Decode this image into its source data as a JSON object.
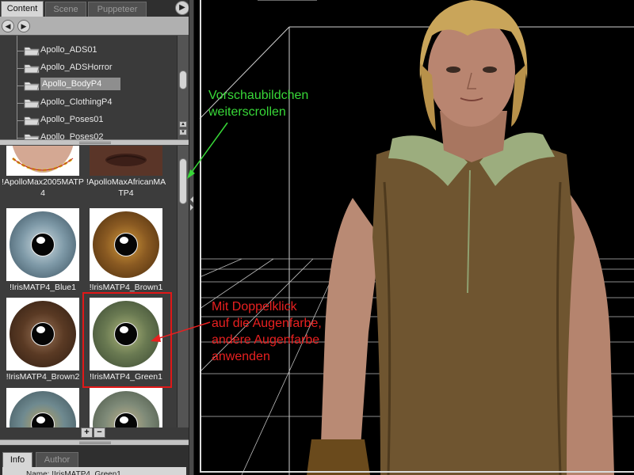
{
  "left_panel": {
    "tabs": [
      {
        "label": "Content",
        "active": true
      },
      {
        "label": "Scene",
        "active": false
      },
      {
        "label": "Puppeteer",
        "active": false
      }
    ],
    "folders": [
      {
        "label": "Apollo_ADS01",
        "selected": false
      },
      {
        "label": "Apollo_ADSHorror",
        "selected": false
      },
      {
        "label": "Apollo_BodyP4",
        "selected": true
      },
      {
        "label": "Apollo_ClothingP4",
        "selected": false
      },
      {
        "label": "Apollo_Poses01",
        "selected": false
      },
      {
        "label": "Apollo_Poses02",
        "selected": false
      }
    ],
    "thumbnails": [
      {
        "caption": "!ApolloMax2005MATP4",
        "kind": "face"
      },
      {
        "caption": "!ApolloMaxAfricanMATP4",
        "kind": "lips"
      },
      {
        "caption": "!IrisMATP4_Blue1",
        "kind": "iris",
        "color": "#7f9aa8"
      },
      {
        "caption": "!IrisMATP4_Brown1",
        "kind": "iris",
        "color": "#8a5a22"
      },
      {
        "caption": "!IrisMATP4_Brown2",
        "kind": "iris",
        "color": "#5a3a24"
      },
      {
        "caption": "!IrisMATP4_Green1",
        "kind": "iris",
        "color": "#6a7a52",
        "highlighted": true
      },
      {
        "caption": "",
        "kind": "iris",
        "color": "#6f8a90"
      },
      {
        "caption": "",
        "kind": "iris",
        "color": "#7e8a78"
      }
    ],
    "zoom_buttons": {
      "plus": "+",
      "minus": "−"
    },
    "info_tabs": [
      {
        "label": "Info",
        "active": true
      },
      {
        "label": "Author",
        "active": false
      }
    ],
    "info_text": "Name: !IrisMATP4_Green1"
  },
  "annotations": {
    "green_lines": [
      "Vorschaubildchen",
      "weiterscrollen"
    ],
    "red_lines": [
      "Mit Doppelklick",
      "auf die Augenfarbe,",
      "andere Augenfarbe",
      "anwenden"
    ]
  },
  "colors": {
    "annotation_green": "#38d838",
    "annotation_red": "#e82020",
    "selection": "#8e8e8e"
  }
}
